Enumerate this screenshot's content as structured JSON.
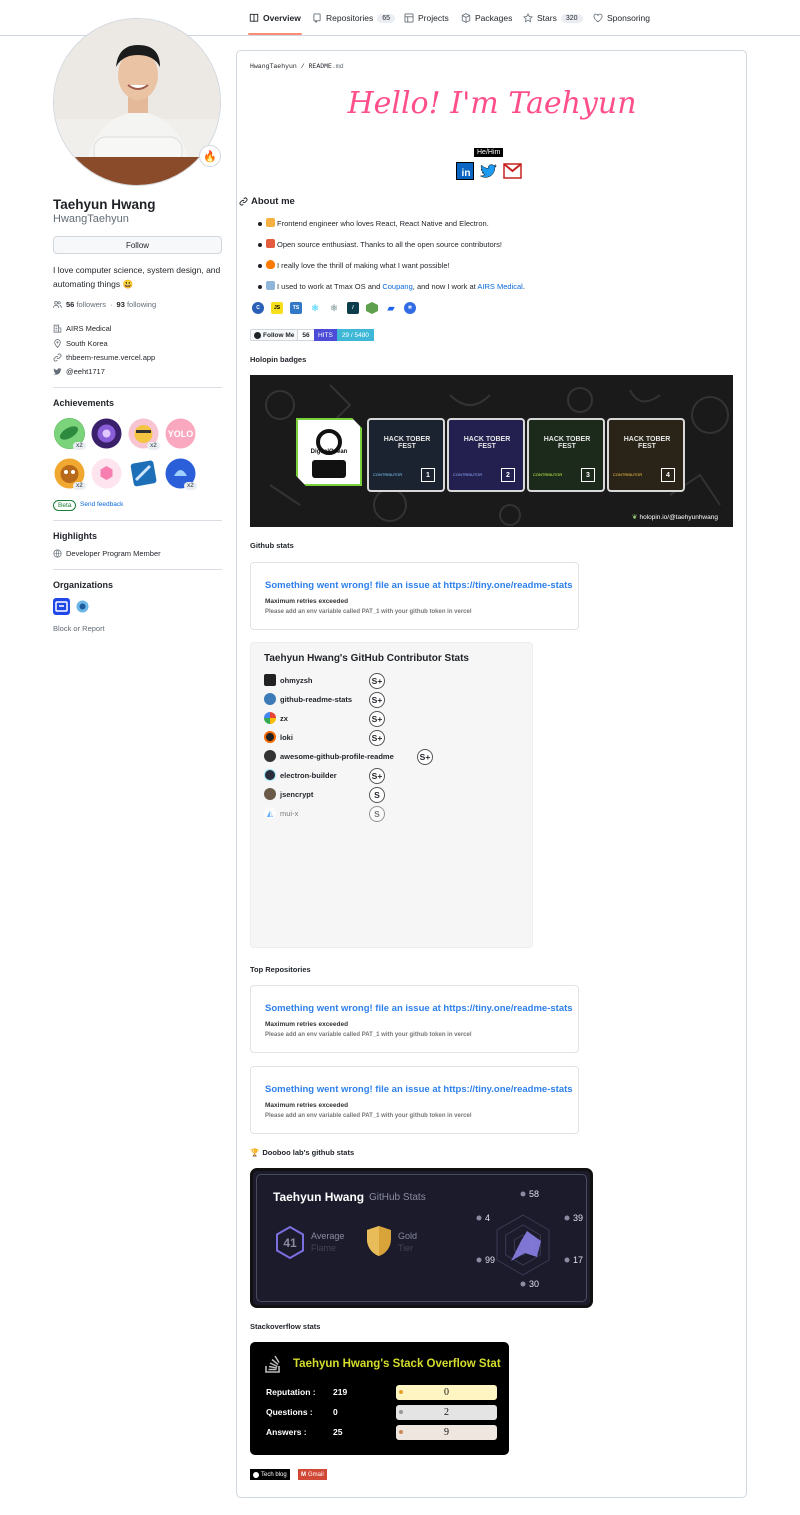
{
  "nav": {
    "tabs": [
      {
        "label": "Overview",
        "count": null
      },
      {
        "label": "Repositories",
        "count": "65"
      },
      {
        "label": "Projects",
        "count": null
      },
      {
        "label": "Packages",
        "count": null
      },
      {
        "label": "Stars",
        "count": "320"
      },
      {
        "label": "Sponsoring",
        "count": null
      }
    ]
  },
  "profile": {
    "status_emoji": "🔥",
    "full_name": "Taehyun Hwang",
    "login": "HwangTaehyun",
    "follow_label": "Follow",
    "bio": "I love computer science, system design, and automating things 😃",
    "followers_count": "56",
    "followers_label": "followers",
    "following_count": "93",
    "following_label": "following",
    "company": "AIRS Medical",
    "location": "South Korea",
    "website": "thbeem-resume.vercel.app",
    "twitter": "@eeht1717"
  },
  "achievements": {
    "title": "Achievements",
    "multiplier": "x2",
    "beta_label": "Beta",
    "feedback_label": "Send feedback"
  },
  "highlights": {
    "title": "Highlights",
    "item": "Developer Program Member"
  },
  "organizations": {
    "title": "Organizations",
    "block_report": "Block or Report"
  },
  "readme": {
    "path_user": "HwangTaehyun",
    "path_sep": "/",
    "path_file": "README",
    "path_ext": ".md",
    "greeting": "Hello! I'm Taehyun",
    "pronouns": "He/Him",
    "about_title": "About me",
    "about_items": [
      {
        "pre": "Frontend engineer who loves React, React Native and Electron.",
        "link": "",
        "mid": "",
        "link2": "",
        "post": ""
      },
      {
        "pre": "Open source enthusiast. Thanks to all the open source contributors!",
        "link": "",
        "mid": "",
        "link2": "",
        "post": ""
      },
      {
        "pre": "I really love the thrill of making what I want possible!",
        "link": "",
        "mid": "",
        "link2": "",
        "post": ""
      },
      {
        "pre": "I used to work at Tmax OS and ",
        "link": "Coupang",
        "mid": ", and now I work at ",
        "link2": "AIRS Medical",
        "post": "."
      }
    ],
    "follow_badge": {
      "label": "Follow Me",
      "count": "56"
    },
    "hits_badge": {
      "label": "HITS",
      "value": "29 / 5480"
    },
    "holopin_title": "Holopin badges",
    "holopin_credit": "holopin.io/@taehyunhwang",
    "holopin_do_label": "DigitalOcean",
    "holopin_badge_text": "HACK TOBER FEST",
    "holopin_contributor": "CONTRIBUTOR",
    "holopin_levels": [
      "1",
      "2",
      "3",
      "4"
    ],
    "github_stats_title": "Github stats",
    "error": {
      "title": "Something went wrong! file an issue at https://tiny.one/readme-stats",
      "msg": "Maximum retries exceeded",
      "hint": "Please add an env variable called PAT_1 with your github token in vercel"
    },
    "contrib": {
      "title": "Taehyun Hwang's GitHub Contributor Stats",
      "rows": [
        {
          "repo": "ohmyzsh",
          "grade": "S+"
        },
        {
          "repo": "github-readme-stats",
          "grade": "S+"
        },
        {
          "repo": "zx",
          "grade": "S+"
        },
        {
          "repo": "loki",
          "grade": "S+"
        },
        {
          "repo": "awesome-github-profile-readme",
          "grade": "S+"
        },
        {
          "repo": "electron-builder",
          "grade": "S+"
        },
        {
          "repo": "jsencrypt",
          "grade": "S"
        },
        {
          "repo": "mui-x",
          "grade": "S"
        }
      ]
    },
    "top_repos_title": "Top Repositories",
    "dooboo_title": "Dooboo lab's github stats",
    "dooboo": {
      "name": "Taehyun Hwang",
      "subtitle": "GitHub Stats",
      "level": "41",
      "level_label": "Average",
      "level_sub": "Flame",
      "tier_label": "Gold",
      "tier_sub": "Tier",
      "radar_values": [
        "58",
        "39",
        "17",
        "30",
        "99",
        "4"
      ]
    },
    "so_title": "Stackoverflow stats",
    "so": {
      "title": "Taehyun Hwang's Stack Overflow Stat",
      "rows": [
        {
          "label": "Reputation :",
          "value": "219",
          "bar": "0"
        },
        {
          "label": "Questions :",
          "value": "0",
          "bar": "2"
        },
        {
          "label": "Answers :",
          "value": "25",
          "bar": "9"
        }
      ]
    },
    "footer_badges": {
      "blog": "Tech blog",
      "gmail": "Gmail"
    }
  },
  "colors": {
    "accent": "#0969da",
    "greeting": "#ff4f8b",
    "tab_underline": "#fd8c73",
    "error_title": "#2f80ed",
    "so_title": "#d4dd2c"
  }
}
